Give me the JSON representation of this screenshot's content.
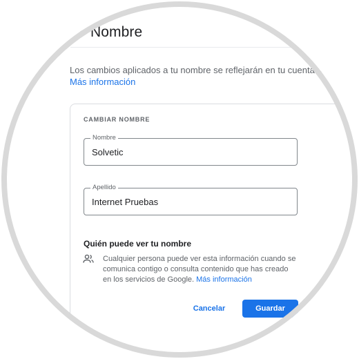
{
  "header": {
    "title": "Nombre"
  },
  "intro": {
    "description": "Los cambios aplicados a tu nombre se reflejarán en tu cuenta d",
    "more_link": "Más información"
  },
  "card": {
    "section_label": "CAMBIAR NOMBRE",
    "first_name": {
      "label": "Nombre",
      "value": "Solvetic"
    },
    "last_name": {
      "label": "Apellido",
      "value": "Internet Pruebas"
    },
    "visibility": {
      "title": "Quién puede ver tu nombre",
      "text": "Cualquier persona puede ver esta información cuando se comunica contigo o consulta contenido que has creado en los servicios de Google.",
      "link": "Más información"
    },
    "cancel_label": "Cancelar",
    "save_label": "Guardar"
  },
  "colors": {
    "accent": "#1a73e8",
    "frame": "#d9d9d9"
  }
}
